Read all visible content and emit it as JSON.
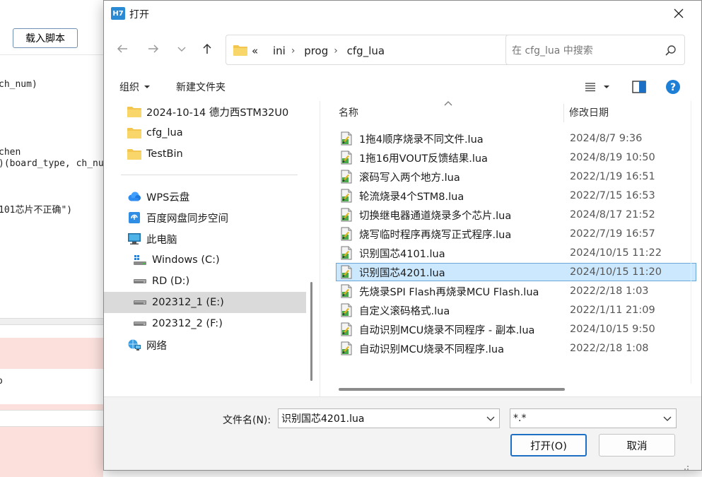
{
  "background": {
    "load_button": "载入脚本",
    "code_lines": [
      "ch_num)",
      "chen",
      ")(board_type, ch_nu",
      "101芯片不正确\")"
    ],
    "log_text": "o"
  },
  "dialog": {
    "app_icon_label": "H7",
    "title": "打开",
    "address": {
      "crumbs": [
        "ini",
        "prog",
        "cfg_lua"
      ],
      "prefix": "«"
    },
    "search": {
      "placeholder": "在 cfg_lua 中搜索"
    },
    "commands": {
      "organize": "组织",
      "new_folder": "新建文件夹"
    },
    "nav": {
      "items": [
        {
          "label": "2024-10-14 德力西STM32U0",
          "icon": "folder-icon"
        },
        {
          "label": "cfg_lua",
          "icon": "folder-icon"
        },
        {
          "label": "TestBin",
          "icon": "folder-icon"
        },
        {
          "label": "WPS云盘",
          "icon": "cloud-icon"
        },
        {
          "label": "百度网盘同步空间",
          "icon": "baidu-sync-icon"
        },
        {
          "label": "此电脑",
          "icon": "computer-icon"
        },
        {
          "label": "Windows (C:)",
          "icon": "windows-drive-icon"
        },
        {
          "label": "RD (D:)",
          "icon": "drive-icon"
        },
        {
          "label": "202312_1 (E:)",
          "icon": "drive-icon"
        },
        {
          "label": "202312_2 (F:)",
          "icon": "drive-icon"
        },
        {
          "label": "网络",
          "icon": "network-icon"
        }
      ],
      "selected_index": 8
    },
    "columns": {
      "name": "名称",
      "modified": "修改日期"
    },
    "files": [
      {
        "name": "1拖4顺序烧录不同文件.lua",
        "date": "2024/8/7 9:36"
      },
      {
        "name": "1拖16用VOUT反馈结果.lua",
        "date": "2024/8/19 10:50"
      },
      {
        "name": "滚码写入两个地方.lua",
        "date": "2022/1/19 16:51"
      },
      {
        "name": "轮流烧录4个STM8.lua",
        "date": "2022/7/15 16:53"
      },
      {
        "name": "切换继电器通道烧录多个芯片.lua",
        "date": "2024/8/17 21:52"
      },
      {
        "name": "烧写临时程序再烧写正式程序.lua",
        "date": "2022/7/19 16:57"
      },
      {
        "name": "识别国芯4101.lua",
        "date": "2024/10/15 11:22"
      },
      {
        "name": "识别国芯4201.lua",
        "date": "2024/10/15 11:20"
      },
      {
        "name": "先烧录SPI Flash再烧录MCU Flash.lua",
        "date": "2022/2/18 1:03"
      },
      {
        "name": "自定义滚码格式.lua",
        "date": "2022/1/11 21:09"
      },
      {
        "name": "自动识别MCU烧录不同程序 - 副本.lua",
        "date": "2024/10/15 9:50"
      },
      {
        "name": "自动识别MCU烧录不同程序.lua",
        "date": "2022/2/18 1:08"
      }
    ],
    "selected_file_index": 7,
    "filename_label": "文件名(N):",
    "filename_value": "识别国芯4201.lua",
    "filetype_value": "*.*",
    "open_button": "打开(O)",
    "cancel_button": "取消",
    "accent": "#1d6fc4",
    "selection_color": "#cce8ff"
  }
}
